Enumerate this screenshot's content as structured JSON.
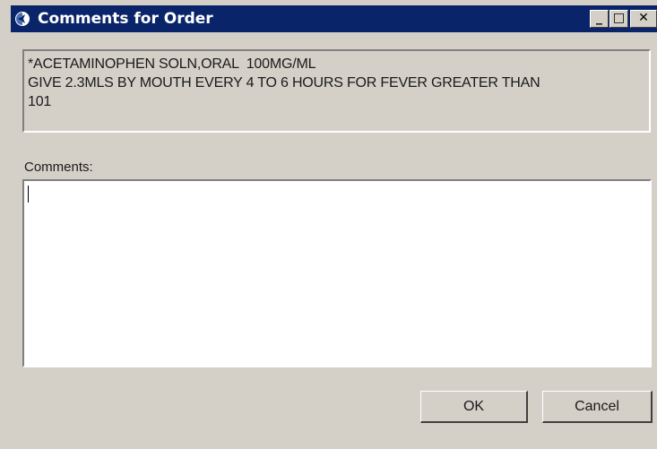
{
  "window": {
    "title": "Comments for Order",
    "minimize_glyph": "_",
    "maximize_glyph": "□",
    "close_glyph": "✕",
    "titlebar_color": "#0a246a"
  },
  "order": {
    "lines": [
      "*ACETAMINOPHEN SOLN,ORAL  100MG/ML",
      "GIVE 2.3MLS BY MOUTH EVERY 4 TO 6 HOURS FOR FEVER GREATER THAN",
      "101"
    ]
  },
  "comments": {
    "label": "Comments:",
    "value": ""
  },
  "buttons": {
    "ok": "OK",
    "cancel": "Cancel"
  }
}
